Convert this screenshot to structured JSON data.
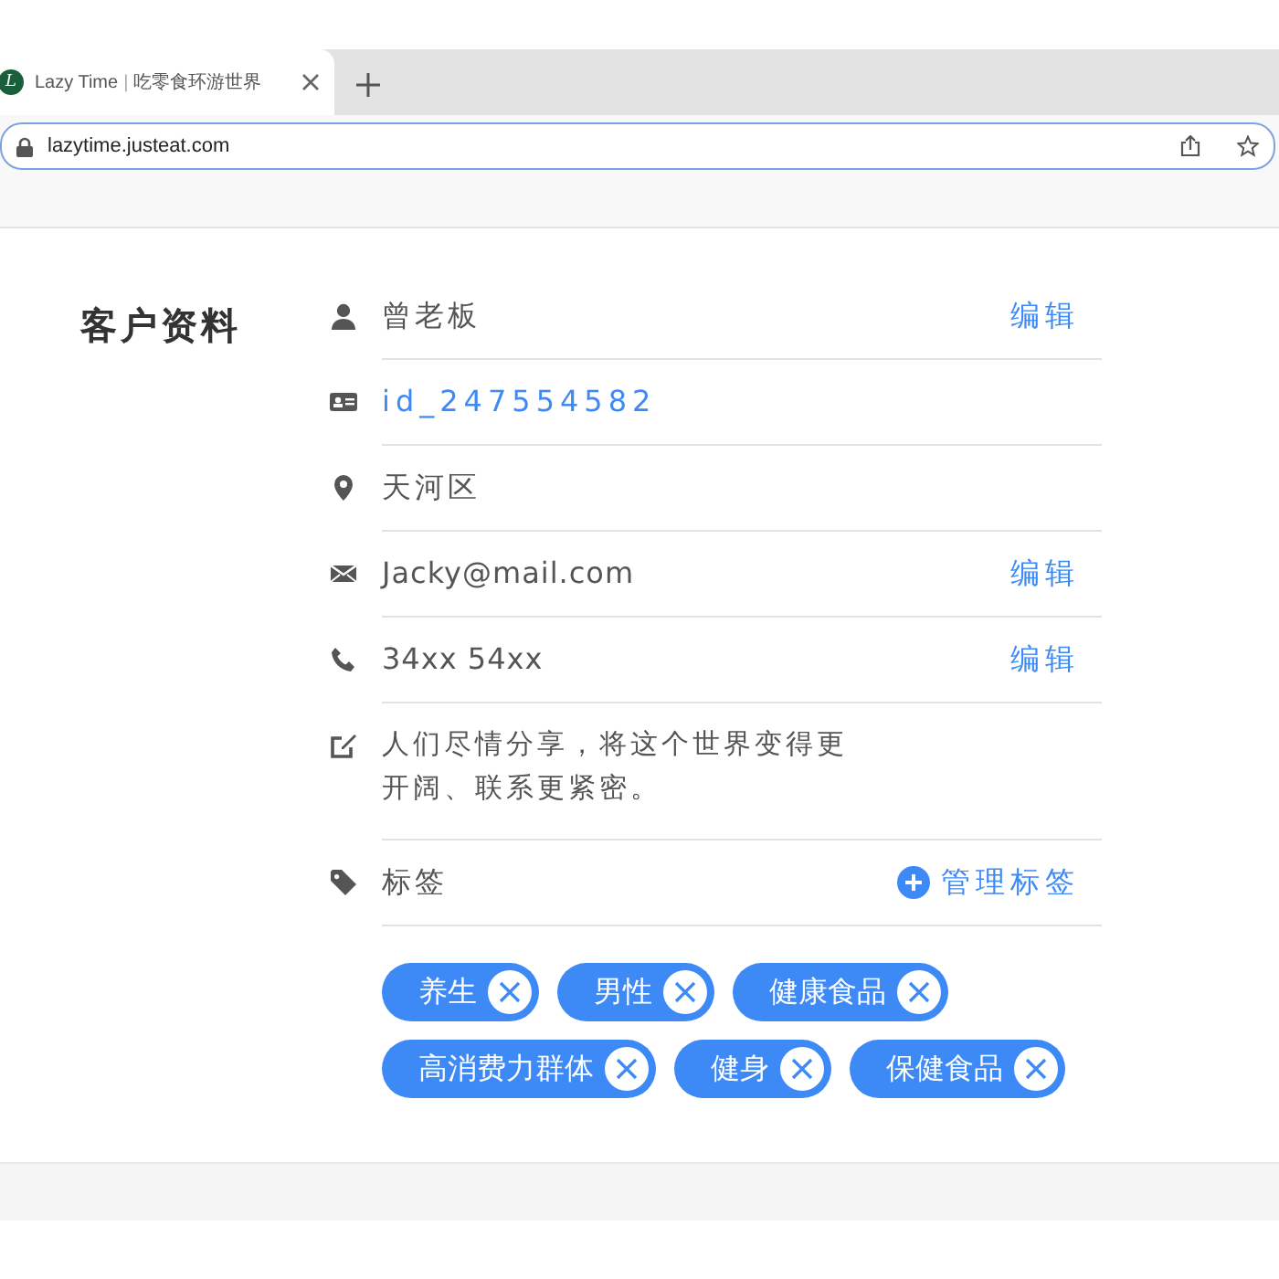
{
  "browser": {
    "tab": {
      "logo_letter": "L",
      "title": "Lazy Time",
      "separator": "|",
      "subtitle": "吃零食环游世界",
      "selected": true
    },
    "address": "lazytime.justeat.com"
  },
  "profile": {
    "title": "客户资料",
    "rows": [
      {
        "kind": "person",
        "text": "曾老板",
        "action": "编辑"
      },
      {
        "kind": "id",
        "text": "id_247554582"
      },
      {
        "kind": "location",
        "text": "天河区"
      },
      {
        "kind": "mail",
        "text": "Jacky@mail.com",
        "action": "编辑"
      },
      {
        "kind": "phone",
        "text": "34xx 54xx",
        "action": "编辑"
      },
      {
        "kind": "note",
        "text": "人们尽情分享，将这个世界变得更开阔、联系更紧密。"
      },
      {
        "kind": "tags",
        "text": "标签",
        "action": "管理标签"
      }
    ],
    "tags": [
      "养生",
      "男性",
      "健康食品",
      "高消费力群体",
      "健身",
      "保健食品"
    ]
  }
}
